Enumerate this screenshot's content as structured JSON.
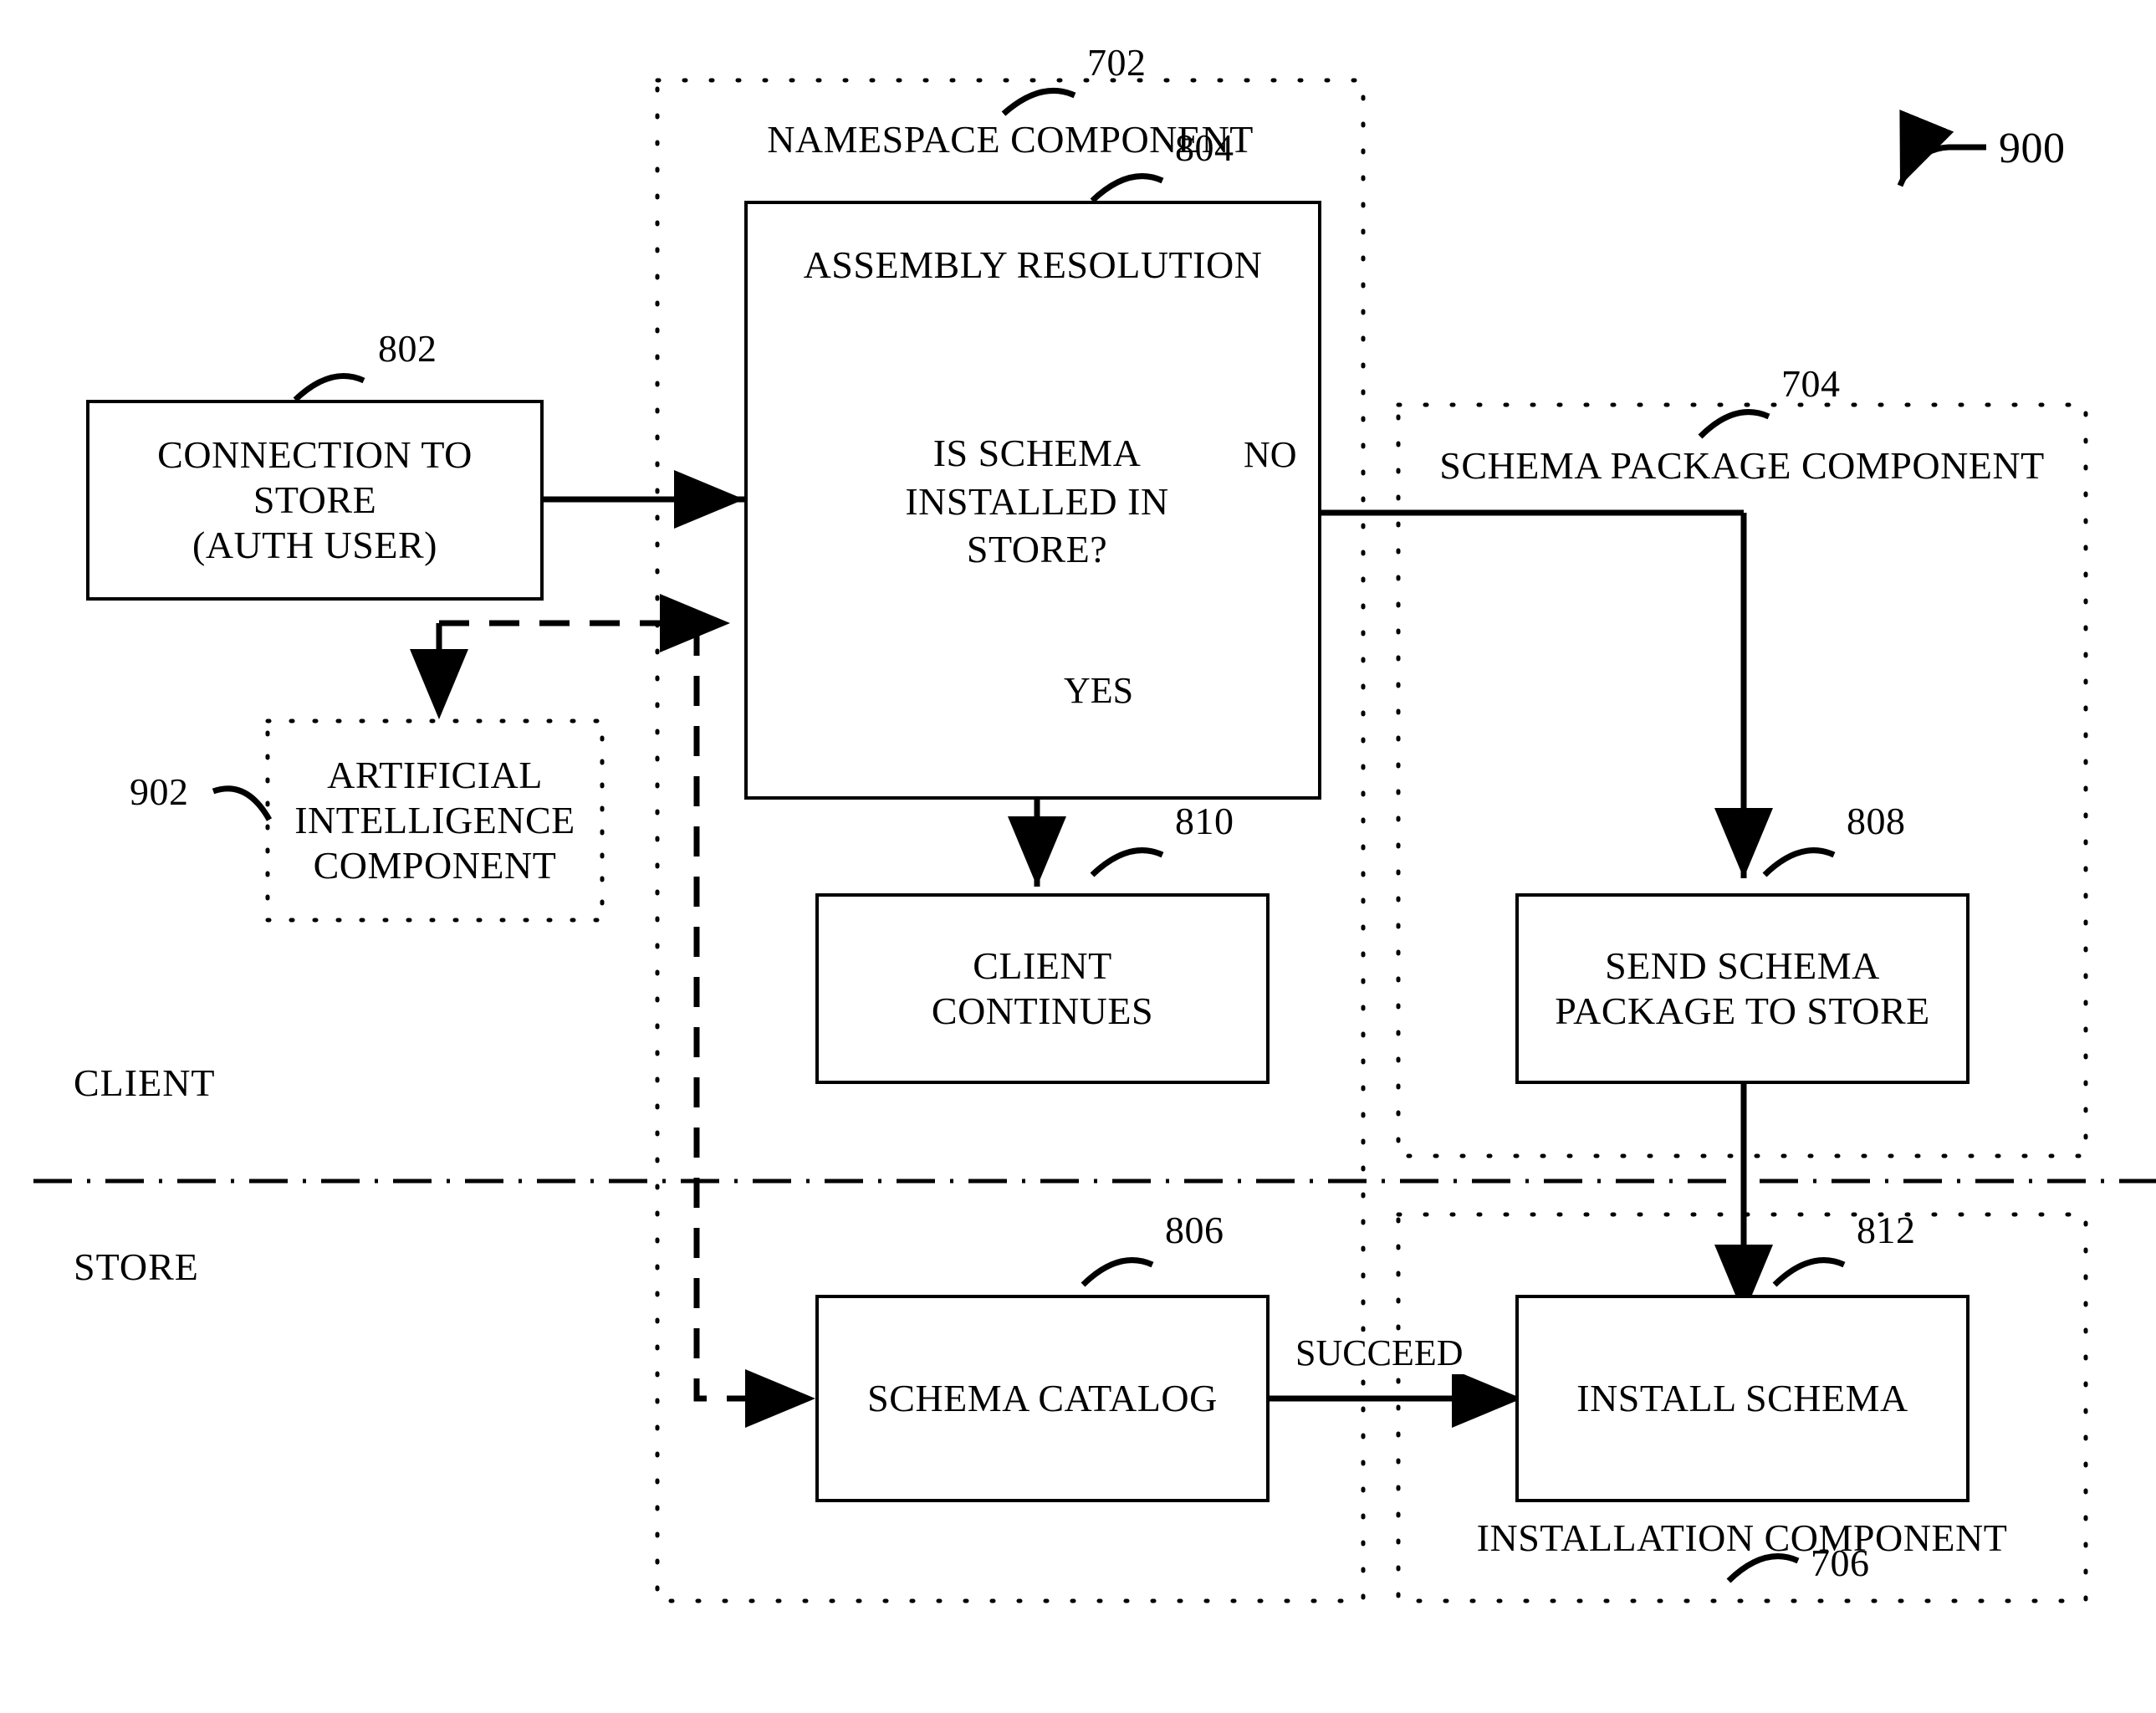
{
  "figure": {
    "number": "900",
    "section_client": "CLIENT",
    "section_store": "STORE"
  },
  "containers": [
    {
      "id": "namespace",
      "ref": "702",
      "label": "NAMESPACE COMPONENT"
    },
    {
      "id": "schema_package",
      "ref": "704",
      "label": "SCHEMA PACKAGE COMPONENT"
    },
    {
      "id": "installation",
      "ref": "706",
      "label": "INSTALLATION COMPONENT"
    }
  ],
  "nodes": {
    "connection": {
      "ref": "802",
      "text": "CONNECTION TO\nSTORE\n(AUTH USER)"
    },
    "assembly": {
      "ref": "804",
      "text": "ASSEMBLY RESOLUTION"
    },
    "decision": {
      "text": "IS SCHEMA\nINSTALLED IN\nSTORE?"
    },
    "ai": {
      "ref": "902",
      "text": "ARTIFICIAL\nINTELLIGENCE\nCOMPONENT"
    },
    "client_continues": {
      "ref": "810",
      "text": "CLIENT\nCONTINUES"
    },
    "send_package": {
      "ref": "808",
      "text": "SEND SCHEMA\nPACKAGE TO STORE"
    },
    "schema_catalog": {
      "ref": "806",
      "text": "SCHEMA CATALOG"
    },
    "install_schema": {
      "ref": "812",
      "text": "INSTALL SCHEMA"
    }
  },
  "edge_labels": {
    "yes": "YES",
    "no": "NO",
    "succeed": "SUCCEED"
  },
  "colors": {
    "ink": "#000000",
    "paper": "#ffffff"
  }
}
